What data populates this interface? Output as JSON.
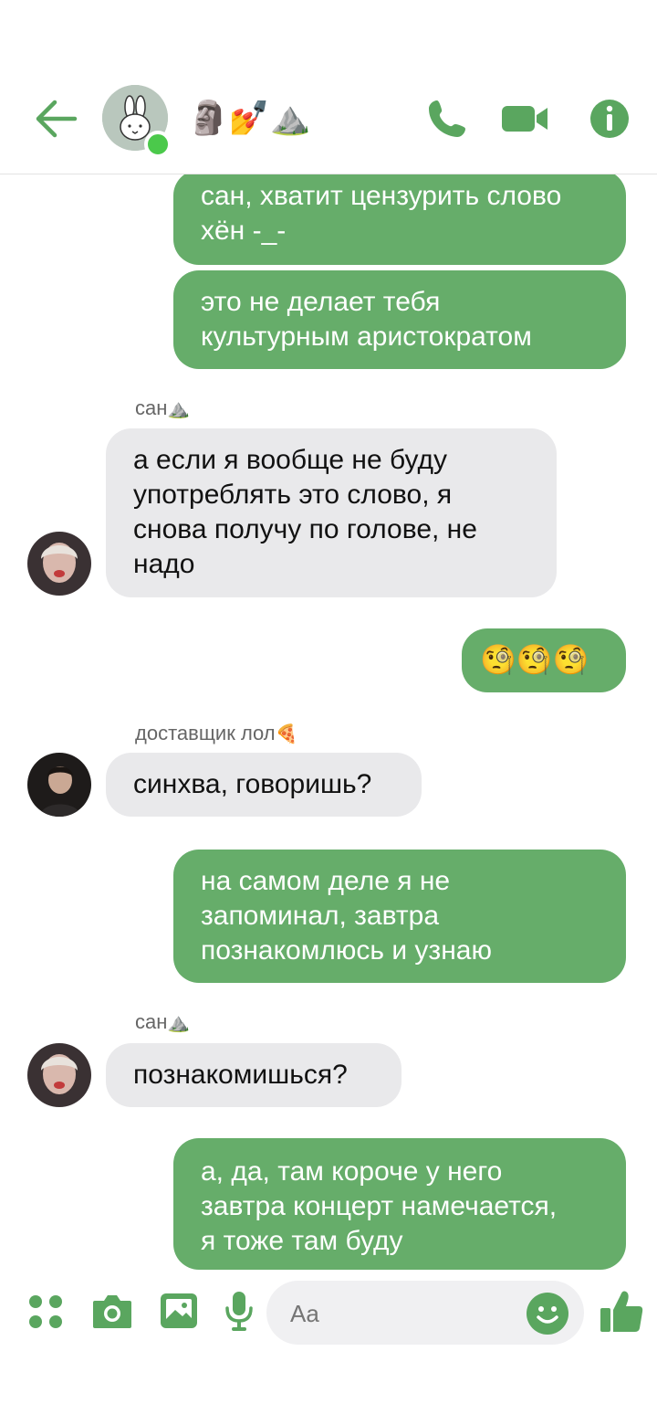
{
  "header": {
    "title": "🗿💅⛰️",
    "accent_color": "#5aa65f",
    "icons": [
      "back-arrow-icon",
      "phone-icon",
      "video-icon",
      "info-icon"
    ]
  },
  "messages": [
    {
      "dir": "out",
      "text": "сан, хватит цензурить слово\nхён -_-"
    },
    {
      "dir": "out",
      "text": "это не делает тебя\nкультурным аристократом"
    },
    {
      "sender": "сан",
      "sender_emoji": "⛰️",
      "dir": "in",
      "text": "а если я вообще не буду\nупотреблять это слово, я\nснова получу по голове, не\nнадо"
    },
    {
      "dir": "out",
      "text": "🧐🧐🧐"
    },
    {
      "sender": "доставщик лол",
      "sender_emoji": "🍕",
      "dir": "in",
      "text": "синхва, говоришь?"
    },
    {
      "dir": "out",
      "text": "на самом деле я не\nзапоминал, завтра\nпознакомлюсь и узнаю"
    },
    {
      "sender": "сан",
      "sender_emoji": "⛰️",
      "dir": "in",
      "text": "познакомишься?"
    },
    {
      "dir": "out",
      "text": "а, да, там короче у него\nзавтра концерт намечается,\nя тоже там буду"
    }
  ],
  "composer": {
    "placeholder": "Aa",
    "icons": [
      "apps-icon",
      "camera-icon",
      "gallery-icon",
      "microphone-icon",
      "emoji-icon",
      "thumbs-up-icon"
    ]
  },
  "colors": {
    "outgoing_bubble": "#66ad6a",
    "incoming_bubble": "#e9e9eb",
    "online": "#4bc94b"
  }
}
